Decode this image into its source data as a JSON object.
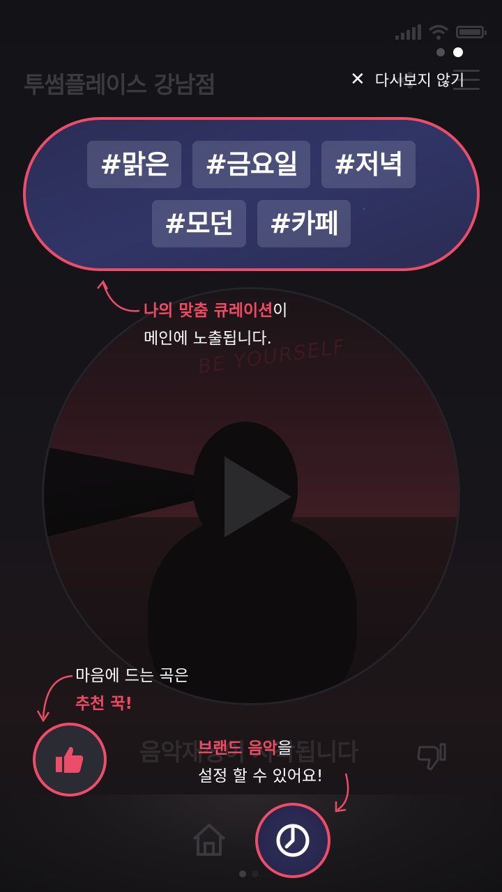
{
  "background": {
    "store_title": "투썸플레이스 강남점",
    "song_title": "음악재생이 시작됩니다",
    "brand_text": "BE YOURSELF"
  },
  "onboarding": {
    "page_indicator": {
      "count": 2,
      "active_index": 1
    },
    "dismiss_label": "다시보지 않기",
    "tags_row1": [
      "#맑은",
      "#금요일",
      "#저녁"
    ],
    "tags_row2": [
      "#모던",
      "#카페"
    ],
    "curation_callout": {
      "accent": "나의 맞춤 큐레이션",
      "rest": "이",
      "line2": "메인에 노출됩니다."
    },
    "like_callout": {
      "line1": "마음에 드는 곡은",
      "accent": "추천 꾹!"
    },
    "brand_callout": {
      "accent": "브랜드 음악",
      "rest": "을",
      "line2": "설정 할 수 있어요!"
    }
  },
  "icons": {
    "like": "thumbs-up-icon",
    "timer": "timer-icon",
    "dismiss": "close-icon",
    "play": "play-icon",
    "home": "home-icon",
    "dislike": "thumbs-down-icon",
    "menu": "menu-icon"
  },
  "colors": {
    "accent": "#ec4d69",
    "tag_card_bg": "#2f3360",
    "overlay_bg": "#111114"
  }
}
